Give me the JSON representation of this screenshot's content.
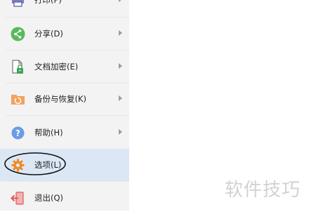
{
  "menu": {
    "items": [
      {
        "label": "打印(P)",
        "icon": "printer-icon",
        "has_submenu": true
      },
      {
        "label": "分享(D)",
        "icon": "share-icon",
        "has_submenu": true
      },
      {
        "label": "文档加密(E)",
        "icon": "document-lock-icon",
        "has_submenu": true
      },
      {
        "label": "备份与恢复(K)",
        "icon": "backup-restore-icon",
        "has_submenu": true
      },
      {
        "label": "帮助(H)",
        "icon": "help-icon",
        "has_submenu": true
      },
      {
        "label": "选项(L)",
        "icon": "gear-icon",
        "has_submenu": false,
        "selected": true
      },
      {
        "label": "退出(Q)",
        "icon": "exit-icon",
        "has_submenu": false
      }
    ]
  },
  "colors": {
    "menu_background": "#f3f3f3",
    "selected_background": "#dce7f5",
    "share_green": "#5cb85c",
    "help_blue": "#6b9ce8",
    "gear_orange": "#f08a24",
    "backup_orange": "#f3a35c",
    "exit_red": "#e05a5a"
  },
  "watermark": {
    "text": "软件技巧"
  }
}
